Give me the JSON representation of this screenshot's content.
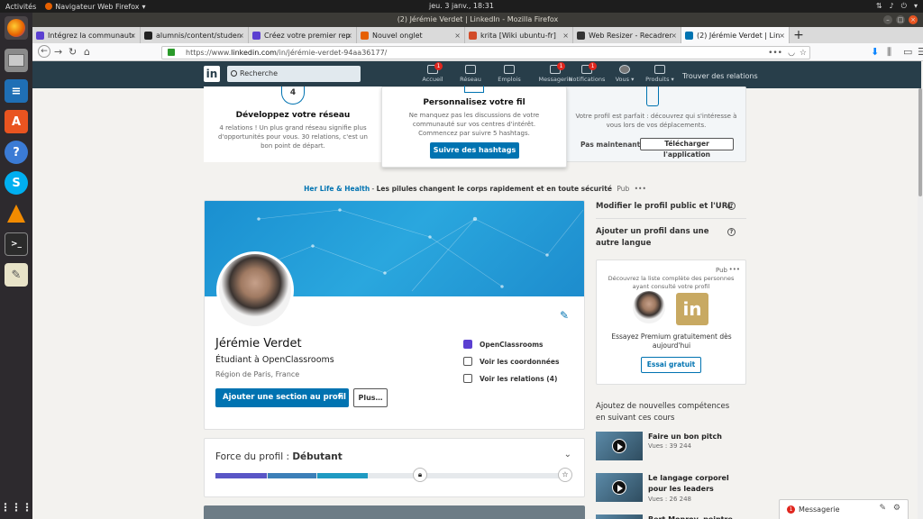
{
  "os": {
    "activities": "Activités",
    "app_name": "Navigateur Web Firefox",
    "clock": "jeu. 3 janv., 18:31"
  },
  "window": {
    "title": "(2) Jérémie Verdet | LinkedIn - Mozilla Firefox"
  },
  "tabs": [
    {
      "label": "Intégrez la communauté",
      "color": "#5b3fd1"
    },
    {
      "label": "alumnis/content/studen",
      "color": "#222222"
    },
    {
      "label": "Créez votre premier rep",
      "color": "#5b3fd1"
    },
    {
      "label": "Nouvel onglet",
      "color": "#e66000"
    },
    {
      "label": "krita [Wiki ubuntu-fr]",
      "color": "#d24b29"
    },
    {
      "label": "Web Resizer - Recadrer e",
      "color": "#333333"
    },
    {
      "label": "(2) Jérémie Verdet | Lin",
      "color": "#0073b1"
    }
  ],
  "url": {
    "prefix": "https://www.",
    "domain": "linkedin.com",
    "path": "/in/jérémie-verdet-94aa36177/"
  },
  "linkedin_nav": {
    "logo": "in",
    "search_placeholder": "Recherche",
    "items": [
      {
        "label": "Accueil",
        "badge": "1"
      },
      {
        "label": "Réseau",
        "badge": ""
      },
      {
        "label": "Emplois",
        "badge": ""
      },
      {
        "label": "Messagerie",
        "badge": "1"
      },
      {
        "label": "Notifications",
        "badge": "1"
      },
      {
        "label": "Vous ▾",
        "badge": ""
      },
      {
        "label": "Produits ▾",
        "badge": ""
      }
    ],
    "trouver": "Trouver des relations"
  },
  "onboarding": {
    "card1": {
      "step": "4",
      "title": "Développez votre réseau",
      "text": "4 relations ! Un plus grand réseau signifie plus d'opportunités pour vous. 30 relations, c'est un bon point de départ."
    },
    "card2": {
      "title": "Personnalisez votre fil",
      "text": "Ne manquez pas les discussions de votre communauté sur vos centres d'intérêt. Commencez par suivre 5 hashtags.",
      "button": "Suivre des hashtags"
    },
    "card3": {
      "text": "Votre profil est parfait : découvrez qui s'intéresse à vous lors de vos déplacements.",
      "later": "Pas maintenant",
      "button": "Télécharger l'application"
    }
  },
  "ad": {
    "sponsor": "Her Life & Health",
    "sep": " - ",
    "text": "Les pilules changent le corps rapidement et en toute sécurité",
    "tag": "Pub",
    "more": "•••"
  },
  "profile": {
    "name": "Jérémie Verdet",
    "headline": "Étudiant à OpenClassrooms",
    "location": "Région de Paris, France",
    "add_section": "Ajouter une section au profil",
    "more": "Plus…",
    "side_items": [
      {
        "icon": "openclassrooms-icon",
        "label": "OpenClassrooms"
      },
      {
        "icon": "contact-icon",
        "label": "Voir les coordonnées"
      },
      {
        "icon": "people-icon",
        "label": "Voir les relations (4)"
      }
    ]
  },
  "strength": {
    "label": "Force du profil : ",
    "level": "Débutant",
    "progress": 0.42
  },
  "sidebar": {
    "edit_public": "Modifier le profil public et l'URL",
    "add_language": "Ajouter un profil dans une autre langue",
    "premium": {
      "tag": "Pub",
      "more": "•••",
      "text": "Découvrez la liste complète des personnes ayant consulté votre profil",
      "cta_text": "Essayez Premium gratuitement dès aujourd'hui",
      "button": "Essai gratuit"
    },
    "skills_title": "Ajoutez de nouvelles compétences en suivant ces cours",
    "courses": [
      {
        "title": "Faire un bon pitch",
        "views": "Vues : 39 244"
      },
      {
        "title": "Le langage corporel pour les leaders",
        "views": "Vues : 26 248"
      },
      {
        "title": "Bert Monroy, peintre",
        "views": ""
      }
    ]
  },
  "messaging": {
    "badge": "1",
    "label": "Messagerie"
  },
  "colors": {
    "linkedin_blue": "#0073b1",
    "header": "#283e4a"
  }
}
